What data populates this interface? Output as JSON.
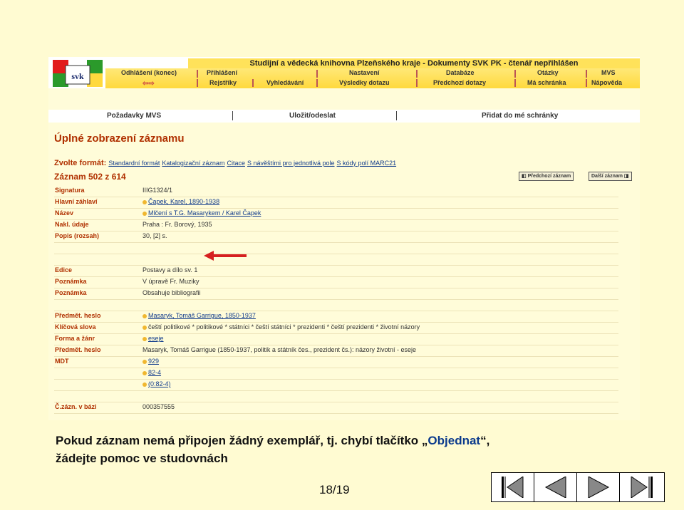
{
  "app": {
    "title": "Studijní a vědecká knihovna Plzeňského kraje - Dokumenty SVK PK - čtenář nepřihlášen",
    "logo_text": "svk"
  },
  "nav": {
    "odhlaseni": "Odhlášení (konec)",
    "prihlaseni": "Přihlášení",
    "rejstriky": "Rejstříky",
    "vyhledavani": "Vyhledávání",
    "nastaveni": "Nastavení",
    "vysledky": "Výsledky dotazu",
    "databaze": "Databáze",
    "predchozi_dotazy": "Předchozí dotazy",
    "otazky": "Otázky",
    "ma_schranka": "Má schránka",
    "mvs": "MVS",
    "napoveda": "Nápověda"
  },
  "actions": {
    "pozadavky": "Požadavky MVS",
    "ulozit": "Uložit/odeslat",
    "pridat": "Přidat do mé schránky"
  },
  "record": {
    "heading": "Úplné zobrazení záznamu",
    "format_label": "Zvolte formát:",
    "formats": [
      "Standardní formát",
      "Katalogizační záznam",
      "Citace",
      "S návěštími pro jednotlivá pole",
      "S kódy polí MARC21"
    ],
    "counter": "Záznam 502 z 614",
    "prev_label": "Předchozí záznam",
    "next_label": "Další záznam",
    "fields": [
      {
        "label": "Signatura",
        "value": "IIIG1324/1",
        "link": false,
        "dot": false
      },
      {
        "label": "Hlavní záhlaví",
        "value": "Čapek, Karel, 1890-1938",
        "link": true,
        "dot": true
      },
      {
        "label": "Název",
        "value": "Mlčení s T.G. Masarykem / Karel Čapek",
        "link": true,
        "dot": true
      },
      {
        "label": "Nakl. údaje",
        "value": "Praha : Fr. Borový, 1935",
        "link": false,
        "dot": false
      },
      {
        "label": "Popis (rozsah)",
        "value": "30, [2] s.",
        "link": false,
        "dot": false
      },
      {
        "label": "",
        "value": "",
        "link": false,
        "dot": false
      },
      {
        "label": "",
        "value": "",
        "link": false,
        "dot": false
      },
      {
        "label": "Edice",
        "value": "Postavy a dílo sv. 1",
        "link": false,
        "dot": false
      },
      {
        "label": "Poznámka",
        "value": "V úpravě Fr. Muziky",
        "link": false,
        "dot": false
      },
      {
        "label": "Poznámka",
        "value": "Obsahuje bibliografii",
        "link": false,
        "dot": false
      },
      {
        "label": "",
        "value": "",
        "link": false,
        "dot": false
      },
      {
        "label": "Předmět. heslo",
        "value": "Masaryk, Tomáš Garrigue, 1850-1937",
        "link": true,
        "dot": true
      },
      {
        "label": "Klíčová slova",
        "value": "čeští politikové * politikové * státníci * čeští státníci * prezidenti * čeští prezidenti * životní názory",
        "link": false,
        "dot": true
      },
      {
        "label": "Forma a žánr",
        "value": "eseje",
        "link": true,
        "dot": true
      },
      {
        "label": "Předmět. heslo",
        "value": "Masaryk, Tomáš Garrigue (1850-1937, politik a státník čes., prezident čs.): názory životní - eseje",
        "link": false,
        "dot": false
      },
      {
        "label": "MDT",
        "value": "929",
        "link": true,
        "dot": true
      },
      {
        "label": "",
        "value": "82-4",
        "link": true,
        "dot": true
      },
      {
        "label": "",
        "value": "(0:82-4)",
        "link": true,
        "dot": true
      },
      {
        "label": "",
        "value": "",
        "link": false,
        "dot": false
      },
      {
        "label": "Č.zázn. v bázi",
        "value": "000357555",
        "link": false,
        "dot": false
      }
    ]
  },
  "caption": {
    "line1_part1": "Pokud záznam nemá připojen žádný exemplář, tj. chybí tlačítko „",
    "line1_highlight": "Objednat",
    "line1_part2": "“,",
    "line2": "žádejte pomoc ve studovnách"
  },
  "slide": {
    "page": "18/19"
  },
  "colors": {
    "accent_red": "#b03000",
    "link_blue": "#123c8c",
    "nav_yellow": "#ffd93d",
    "page_bg": "#fffbd2"
  }
}
